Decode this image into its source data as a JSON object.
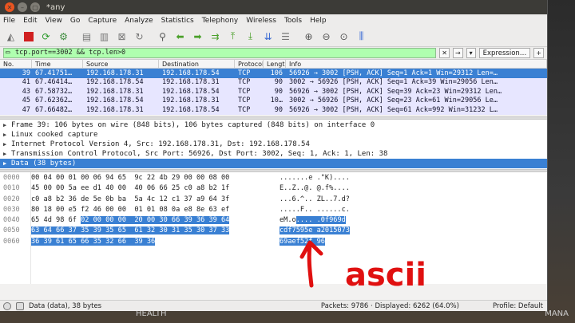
{
  "window": {
    "title": "*any"
  },
  "menu": [
    "File",
    "Edit",
    "View",
    "Go",
    "Capture",
    "Analyze",
    "Statistics",
    "Telephony",
    "Wireless",
    "Tools",
    "Help"
  ],
  "filter": {
    "value": "tcp.port==3002 && tcp.len>0",
    "expression_label": "Expression…",
    "plus": "+"
  },
  "columns": {
    "no": "No.",
    "time": "Time",
    "source": "Source",
    "destination": "Destination",
    "protocol": "Protocol",
    "length": "Length",
    "info": "Info"
  },
  "packets": [
    {
      "no": "39",
      "time": "67.41751…",
      "src": "192.168.178.31",
      "dst": "192.168.178.54",
      "proto": "TCP",
      "len": "106",
      "info": "56926 → 3002 [PSH, ACK] Seq=1 Ack=1 Win=29312 Len=…"
    },
    {
      "no": "41",
      "time": "67.46414…",
      "src": "192.168.178.54",
      "dst": "192.168.178.31",
      "proto": "TCP",
      "len": "90",
      "info": "3002 → 56926 [PSH, ACK] Seq=1 Ack=39 Win=29056 Len…"
    },
    {
      "no": "43",
      "time": "67.58732…",
      "src": "192.168.178.31",
      "dst": "192.168.178.54",
      "proto": "TCP",
      "len": "90",
      "info": "56926 → 3002 [PSH, ACK] Seq=39 Ack=23 Win=29312 Len…"
    },
    {
      "no": "45",
      "time": "67.62362…",
      "src": "192.168.178.54",
      "dst": "192.168.178.31",
      "proto": "TCP",
      "len": "10…",
      "info": "3002 → 56926 [PSH, ACK] Seq=23 Ack=61 Win=29056 Le…"
    },
    {
      "no": "47",
      "time": "67.66482…",
      "src": "192.168.178.31",
      "dst": "192.168.178.54",
      "proto": "TCP",
      "len": "90",
      "info": "56926 → 3002 [PSH, ACK] Seq=61 Ack=992 Win=31232 L…"
    }
  ],
  "details": [
    {
      "text": "Frame 39: 106 bytes on wire (848 bits), 106 bytes captured (848 bits) on interface 0"
    },
    {
      "text": "Linux cooked capture"
    },
    {
      "text": "Internet Protocol Version 4, Src: 192.168.178.31, Dst: 192.168.178.54"
    },
    {
      "text": "Transmission Control Protocol, Src Port: 56926, Dst Port: 3002, Seq: 1, Ack: 1, Len: 38"
    },
    {
      "text": "Data (38 bytes)"
    }
  ],
  "bytes": [
    {
      "off": "0000",
      "hex": "00 04 00 01 00 06 94 65  9c 22 4b 29 00 00 08 00",
      "hex_hl": "",
      "asc": ".......e .\"K)....",
      "asc_hl": ""
    },
    {
      "off": "0010",
      "hex": "45 00 00 5a ee d1 40 00  40 06 66 25 c0 a8 b2 1f",
      "hex_hl": "",
      "asc": "E..Z..@. @.f%....",
      "asc_hl": ""
    },
    {
      "off": "0020",
      "hex": "c0 a8 b2 36 de 5e 0b ba  5a 4c 12 c1 37 a9 64 3f",
      "hex_hl": "",
      "asc": "...6.^.. ZL..7.d?",
      "asc_hl": ""
    },
    {
      "off": "0030",
      "hex": "80 18 00 e5 f2 46 00 00  01 01 08 0a e8 8e 63 ef",
      "hex_hl": "",
      "asc": ".....F.. ......c.",
      "asc_hl": ""
    },
    {
      "off": "0040",
      "hex": "65 4d 98 6f ",
      "hex_hl": "02 00 00 00  20 00 30 66 39 36 39 64",
      "asc": "eM.o",
      "asc_hl": ".... .0f969d"
    },
    {
      "off": "0050",
      "hex": "",
      "hex_hl": "63 64 66 37 35 39 35 65  61 32 30 31 35 30 37 33",
      "asc": "",
      "asc_hl": "cdf7595e a2015073"
    },
    {
      "off": "0060",
      "hex": "",
      "hex_hl": "36 39 61 65 66 35 32 66  39 36",
      "asc": "",
      "asc_hl": "69aef52f 96"
    }
  ],
  "annotation": {
    "text": "ascii",
    "color": "#e01010"
  },
  "status": {
    "left": "Data (data), 38 bytes",
    "packets": "Packets: 9786 · Displayed: 6262 (64.0%)",
    "profile": "Profile: Default"
  },
  "background": {
    "hud_left": "HEALTH",
    "hud_right": "MANA"
  },
  "colors": {
    "selected": "#3a80d3",
    "row_bg": "#e7e6ff",
    "filter_ok": "#afffaf",
    "close": "#e95420"
  }
}
